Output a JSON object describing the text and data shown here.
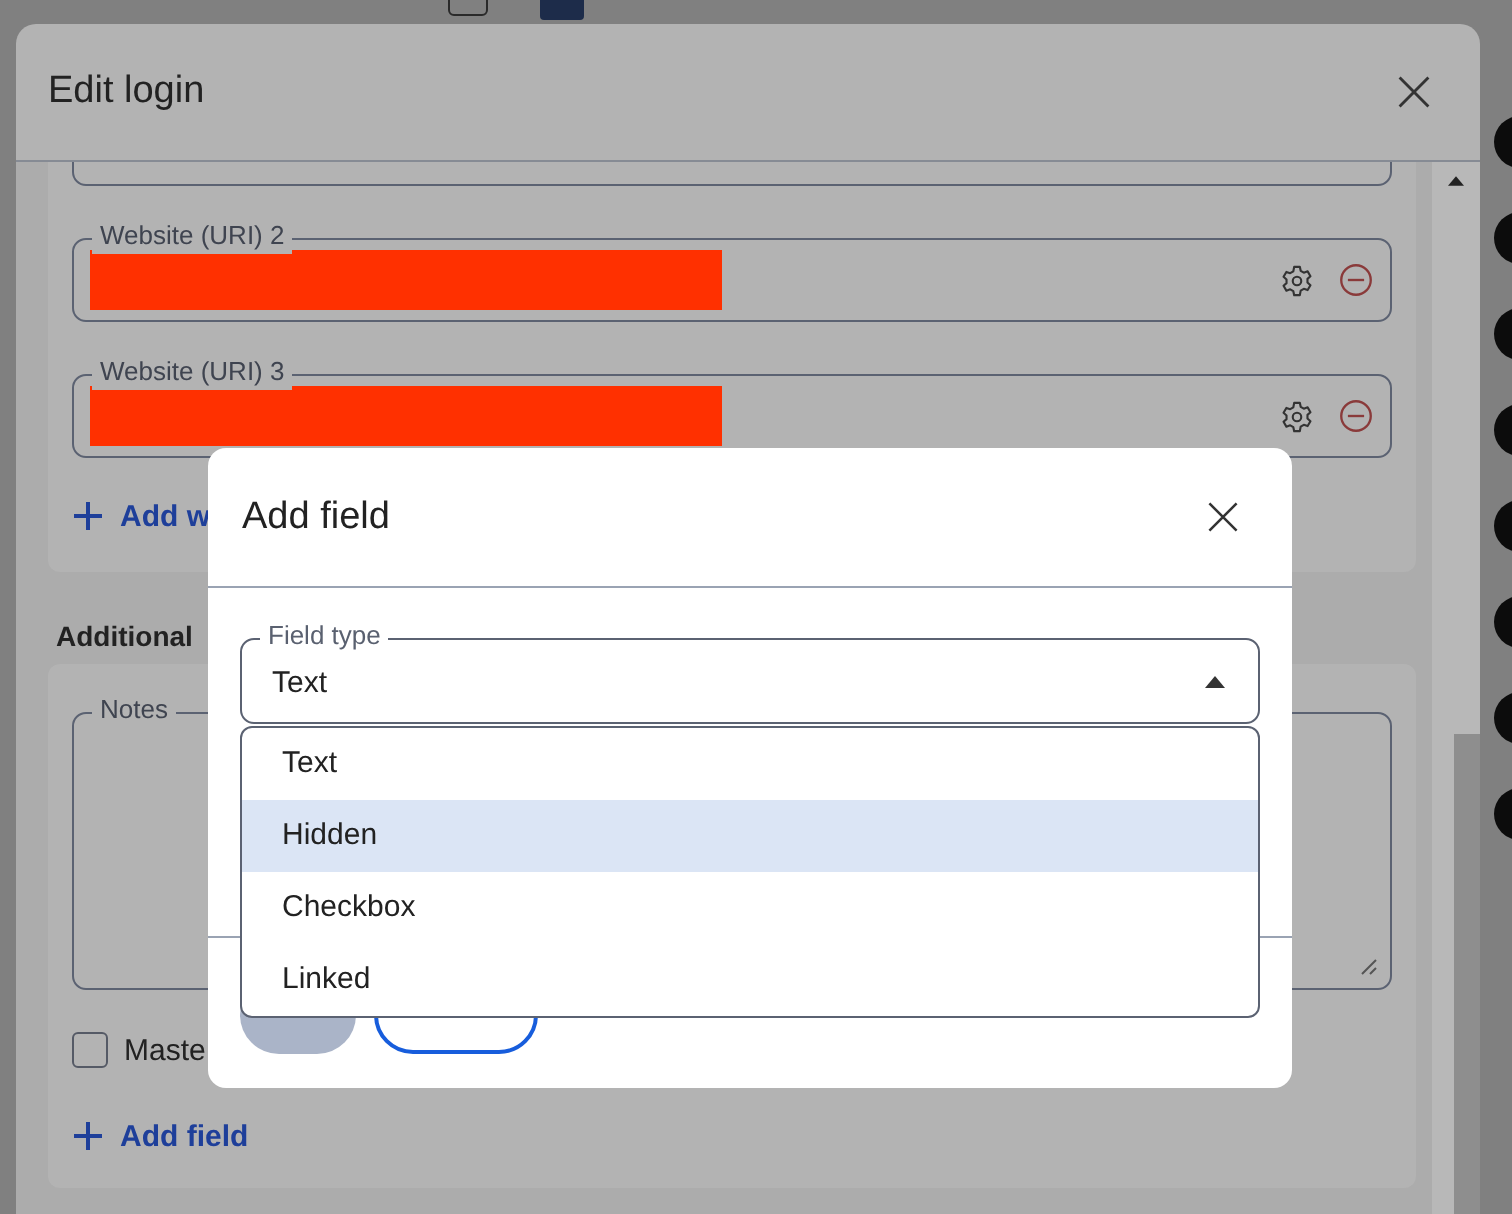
{
  "background_row": {
    "checked": false
  },
  "edit_dialog": {
    "title": "Edit login",
    "uri_fields": [
      {
        "label": "Website (URI) 2",
        "redacted": true
      },
      {
        "label": "Website (URI) 3",
        "redacted": true
      }
    ],
    "add_website": "Add w",
    "section_label": "Additional",
    "notes_label": "Notes",
    "checkbox": {
      "label": "Maste",
      "checked": false
    },
    "add_field": "Add field"
  },
  "add_field_dialog": {
    "title": "Add field",
    "field_type": {
      "label": "Field type",
      "value": "Text",
      "expanded": true
    },
    "options": [
      {
        "label": "Text",
        "selected": false
      },
      {
        "label": "Hidden",
        "selected": true
      },
      {
        "label": "Checkbox",
        "selected": false
      },
      {
        "label": "Linked",
        "selected": false
      }
    ],
    "buttons": [
      {
        "kind": "primary",
        "disabled": true
      },
      {
        "kind": "secondary",
        "disabled": false
      }
    ]
  }
}
